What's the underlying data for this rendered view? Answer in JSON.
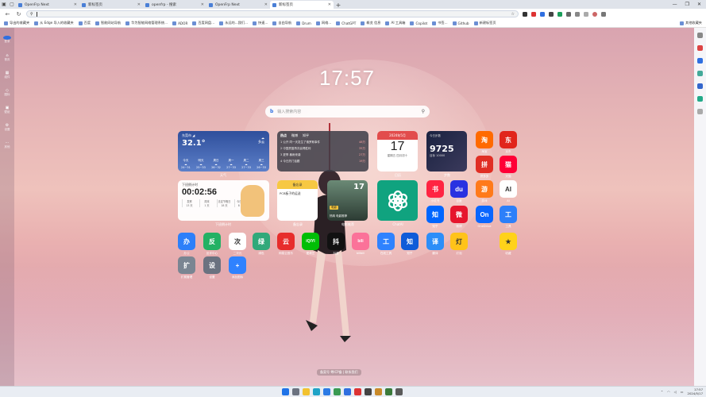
{
  "browser": {
    "tabs": [
      {
        "label": "OpenFrp Next"
      },
      {
        "label": "新标签页"
      },
      {
        "label": "openfrp - 搜索"
      },
      {
        "label": "OpenFrp Next"
      },
      {
        "label": "新标签页"
      }
    ],
    "new_tab": "+",
    "window_controls": [
      "—",
      "❐",
      "✕"
    ],
    "address_value": "",
    "bookmarks": [
      "导出的收藏夹",
      "从 Edge 导入的收藏夹",
      "百度",
      "智能网站导航",
      "华为智能网络管理系统...",
      "ADOR",
      "百度网盘...",
      "永远的...我们...",
      "快速...",
      "自由导航",
      "Drum",
      "网络...",
      "ChatGPT",
      "概览 信息",
      "AI 工具箱",
      "Copilot",
      "书签...",
      "Github",
      "新建标签页"
    ],
    "bookmarks_right": "其他收藏夹"
  },
  "rail": {
    "items": [
      {
        "label": "登录"
      },
      {
        "label": "首页"
      },
      {
        "label": "组件"
      },
      {
        "label": "图标"
      },
      {
        "label": "壁纸"
      },
      {
        "label": "设置"
      },
      {
        "label": "其他"
      }
    ]
  },
  "clock": {
    "time": "17:57"
  },
  "search": {
    "placeholder": "输入搜索内容",
    "engine": "b"
  },
  "widgets": {
    "weather": {
      "city": "东莞市 ◢",
      "temp": "32.1°",
      "condition": "多云",
      "days": [
        {
          "name": "今天",
          "range": "24~31"
        },
        {
          "name": "明天",
          "range": "25~33"
        },
        {
          "name": "周日",
          "range": "26~32"
        },
        {
          "name": "周一",
          "range": "27~33"
        },
        {
          "name": "周二",
          "range": "27~33"
        },
        {
          "name": "周三",
          "range": "26~33"
        }
      ],
      "label": "天气"
    },
    "news": {
      "tabs": [
        "热点",
        "微博",
        "知乎"
      ],
      "rows": [
        {
          "title": "1 公开 同一天发生了俄罗斯事件",
          "hot": "48万"
        },
        {
          "title": "2 中国男篮再次赢得胜利",
          "hot": "35万"
        },
        {
          "title": "3 夏季 暴雨来袭",
          "hot": "27万"
        },
        {
          "title": "4 今日热门话题",
          "hot": "19万"
        }
      ],
      "label": "热搜"
    },
    "calendar": {
      "month": "2024年5月",
      "day": "17",
      "lunar": "星期五 四月初十",
      "label": "日历"
    },
    "steps": {
      "title": "今日步数",
      "value": "9725",
      "sub": "目标 10000",
      "label": "步数"
    },
    "timer": {
      "title": "下班倒计时",
      "value": "00:02:56",
      "cells": [
        {
          "k": "发薪",
          "v": "13 天"
        },
        {
          "k": "周末",
          "v": "1 天"
        },
        {
          "k": "法定节假日",
          "v": "18 天"
        },
        {
          "k": "今日工作",
          "v": "8 小时"
        }
      ],
      "label": "下班倒计时"
    },
    "memo": {
      "title": "备忘录",
      "text": "PCB板子的运送",
      "label": "备忘录"
    },
    "movie": {
      "num": "17",
      "badge": "电影",
      "caption": "热映 电影推荐",
      "label": "电影推荐"
    },
    "gpt": {
      "label": "ChatAI"
    }
  },
  "apps": [
    {
      "name": "淘宝",
      "glyph": "淘",
      "color": "#ff6a00"
    },
    {
      "name": "京东",
      "glyph": "东",
      "color": "#e1251b"
    },
    {
      "name": "拼多多",
      "glyph": "拼",
      "color": "#e02e24"
    },
    {
      "name": "天猫",
      "glyph": "猫",
      "color": "#ff0036"
    },
    {
      "name": "小红书",
      "glyph": "书",
      "color": "#ff2442"
    },
    {
      "name": "百度",
      "glyph": "du",
      "color": "#2932e1"
    },
    {
      "name": "游戏",
      "glyph": "游",
      "color": "#ff7a1a"
    },
    {
      "name": "AI",
      "glyph": "AI",
      "color": "#ffffff"
    },
    {
      "name": "知乎",
      "glyph": "知",
      "color": "#0066ff"
    },
    {
      "name": "微博",
      "glyph": "微",
      "color": "#e6162d"
    },
    {
      "name": "OneDrive",
      "glyph": "On",
      "color": "#0a66ff"
    },
    {
      "name": "工具",
      "glyph": "工",
      "color": "#2d7ff9"
    },
    {
      "name": "办公",
      "glyph": "办",
      "color": "#2d7ff9"
    },
    {
      "name": "反诈中心",
      "glyph": "反",
      "color": "#24b164"
    },
    {
      "name": "二次元",
      "glyph": "次",
      "color": "#ffffff"
    },
    {
      "name": "绿色",
      "glyph": "绿",
      "color": "#31a97a"
    },
    {
      "name": "网易云音乐",
      "glyph": "云",
      "color": "#e72d2c"
    },
    {
      "name": "爱奇艺",
      "glyph": "iQIYI",
      "color": "#00be06"
    },
    {
      "name": "抖音",
      "glyph": "抖",
      "color": "#111111"
    },
    {
      "name": "bilibili",
      "glyph": "bili",
      "color": "#fb7299"
    },
    {
      "name": "在线工具",
      "glyph": "工",
      "color": "#2f82ff"
    },
    {
      "name": "知乎",
      "glyph": "知",
      "color": "#0f5bd8"
    },
    {
      "name": "翻译",
      "glyph": "译",
      "color": "#2c8ef8"
    },
    {
      "name": "灯泡",
      "glyph": "灯",
      "color": "#ffc31a"
    },
    {
      "name": "收藏",
      "glyph": "★",
      "color": "#ffd21a"
    },
    {
      "name": "扩展管理",
      "glyph": "扩",
      "color": "#7a8592"
    },
    {
      "name": "设置",
      "glyph": "设",
      "color": "#6b7280"
    },
    {
      "name": "添加图标",
      "glyph": "+",
      "color": "#2f82ff"
    }
  ],
  "footer": {
    "text": "备案号 粤ICP备 | 联系我们"
  },
  "taskbar": {
    "time": "17:57",
    "date": "2024/5/17"
  }
}
